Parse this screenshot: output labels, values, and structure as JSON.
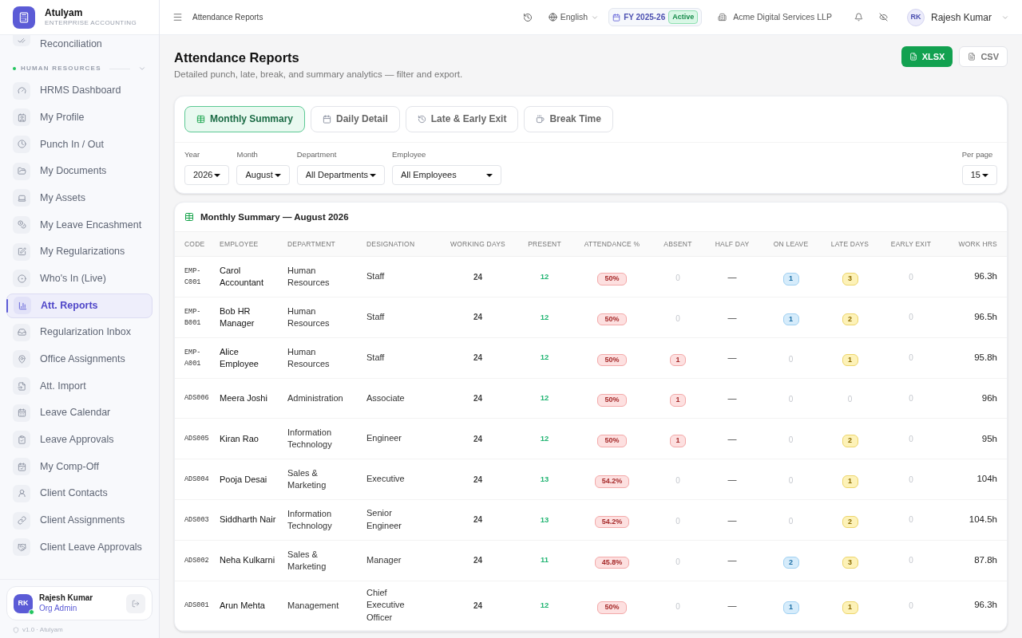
{
  "brand": {
    "name": "Atulyam",
    "tagline": "ENTERPRISE ACCOUNTING"
  },
  "sidebar": {
    "partial_item": "Reconciliation",
    "section": {
      "title": "HUMAN RESOURCES",
      "expanded": true
    },
    "items": [
      {
        "label": "HRMS Dashboard",
        "selected": false
      },
      {
        "label": "My Profile",
        "selected": false
      },
      {
        "label": "Punch In / Out",
        "selected": false
      },
      {
        "label": "My Documents",
        "selected": false
      },
      {
        "label": "My Assets",
        "selected": false
      },
      {
        "label": "My Leave Encashment",
        "selected": false
      },
      {
        "label": "My Regularizations",
        "selected": false
      },
      {
        "label": "Who's In (Live)",
        "selected": false
      },
      {
        "label": "Att. Reports",
        "selected": true
      },
      {
        "label": "Regularization Inbox",
        "selected": false
      },
      {
        "label": "Office Assignments",
        "selected": false
      },
      {
        "label": "Att. Import",
        "selected": false
      },
      {
        "label": "Leave Calendar",
        "selected": false
      },
      {
        "label": "Leave Approvals",
        "selected": false
      },
      {
        "label": "My Comp-Off",
        "selected": false
      },
      {
        "label": "Client Contacts",
        "selected": false
      },
      {
        "label": "Client Assignments",
        "selected": false
      },
      {
        "label": "Client Leave Approvals",
        "selected": false
      }
    ],
    "user": {
      "initials": "RK",
      "name": "Rajesh Kumar",
      "role": "Org Admin",
      "online": true
    },
    "version": "v1.0 · Atulyam"
  },
  "topbar": {
    "breadcrumb": "Attendance Reports",
    "language": "English",
    "fiscal_year": "FY 2025-26",
    "fy_status": "Active",
    "company": "Acme Digital Services LLP",
    "user_initials": "RK",
    "user_name": "Rajesh Kumar"
  },
  "page": {
    "title": "Attendance Reports",
    "subtitle": "Detailed punch, late, break, and summary analytics — filter and export.",
    "export_buttons": [
      "XLSX",
      "CSV"
    ]
  },
  "tabs": [
    {
      "label": "Monthly Summary",
      "selected": true
    },
    {
      "label": "Daily Detail",
      "selected": false
    },
    {
      "label": "Late & Early Exit",
      "selected": false
    },
    {
      "label": "Break Time",
      "selected": false
    }
  ],
  "filters": [
    {
      "label": "Year",
      "value": "2026"
    },
    {
      "label": "Month",
      "value": "August"
    },
    {
      "label": "Department",
      "value": "All Departments"
    },
    {
      "label": "Employee",
      "value": "All Employees"
    }
  ],
  "per_page": {
    "label": "Per page",
    "value": "15"
  },
  "table": {
    "title": "Monthly Summary — August 2026",
    "columns": [
      "CODE",
      "EMPLOYEE",
      "DEPARTMENT",
      "DESIGNATION",
      "WORKING DAYS",
      "PRESENT",
      "ATTENDANCE %",
      "ABSENT",
      "HALF DAY",
      "ON LEAVE",
      "LATE DAYS",
      "EARLY EXIT",
      "WORK HRS"
    ],
    "rows": [
      {
        "code": "EMP-C001",
        "employee": "Carol Accountant",
        "department": "Human Resources",
        "designation": "Staff",
        "working_days": "24",
        "present": "12",
        "attendance": "50%",
        "absent": {
          "text": "0",
          "flagged": false
        },
        "half_day": "—",
        "on_leave": {
          "text": "1",
          "flagged": true
        },
        "late_days": {
          "text": "3",
          "flagged": true
        },
        "early_exit": "0",
        "work_hrs": "96.3h"
      },
      {
        "code": "EMP-B001",
        "employee": "Bob HR Manager",
        "department": "Human Resources",
        "designation": "Staff",
        "working_days": "24",
        "present": "12",
        "attendance": "50%",
        "absent": {
          "text": "0",
          "flagged": false
        },
        "half_day": "—",
        "on_leave": {
          "text": "1",
          "flagged": true
        },
        "late_days": {
          "text": "2",
          "flagged": true
        },
        "early_exit": "0",
        "work_hrs": "96.5h"
      },
      {
        "code": "EMP-A001",
        "employee": "Alice Employee",
        "department": "Human Resources",
        "designation": "Staff",
        "working_days": "24",
        "present": "12",
        "attendance": "50%",
        "absent": {
          "text": "1",
          "flagged": true
        },
        "half_day": "—",
        "on_leave": {
          "text": "0",
          "flagged": false
        },
        "late_days": {
          "text": "1",
          "flagged": true
        },
        "early_exit": "0",
        "work_hrs": "95.8h"
      },
      {
        "code": "ADS006",
        "employee": "Meera Joshi",
        "department": "Administration",
        "designation": "Associate",
        "working_days": "24",
        "present": "12",
        "attendance": "50%",
        "absent": {
          "text": "1",
          "flagged": true
        },
        "half_day": "—",
        "on_leave": {
          "text": "0",
          "flagged": false
        },
        "late_days": {
          "text": "0",
          "flagged": false
        },
        "early_exit": "0",
        "work_hrs": "96h"
      },
      {
        "code": "ADS005",
        "employee": "Kiran Rao",
        "department": "Information Technology",
        "designation": "Engineer",
        "working_days": "24",
        "present": "12",
        "attendance": "50%",
        "absent": {
          "text": "1",
          "flagged": true
        },
        "half_day": "—",
        "on_leave": {
          "text": "0",
          "flagged": false
        },
        "late_days": {
          "text": "2",
          "flagged": true
        },
        "early_exit": "0",
        "work_hrs": "95h"
      },
      {
        "code": "ADS004",
        "employee": "Pooja Desai",
        "department": "Sales & Marketing",
        "designation": "Executive",
        "working_days": "24",
        "present": "13",
        "attendance": "54.2%",
        "absent": {
          "text": "0",
          "flagged": false
        },
        "half_day": "—",
        "on_leave": {
          "text": "0",
          "flagged": false
        },
        "late_days": {
          "text": "1",
          "flagged": true
        },
        "early_exit": "0",
        "work_hrs": "104h"
      },
      {
        "code": "ADS003",
        "employee": "Siddharth Nair",
        "department": "Information Technology",
        "designation": "Senior Engineer",
        "working_days": "24",
        "present": "13",
        "attendance": "54.2%",
        "absent": {
          "text": "0",
          "flagged": false
        },
        "half_day": "—",
        "on_leave": {
          "text": "0",
          "flagged": false
        },
        "late_days": {
          "text": "2",
          "flagged": true
        },
        "early_exit": "0",
        "work_hrs": "104.5h"
      },
      {
        "code": "ADS002",
        "employee": "Neha Kulkarni",
        "department": "Sales & Marketing",
        "designation": "Manager",
        "working_days": "24",
        "present": "11",
        "attendance": "45.8%",
        "absent": {
          "text": "0",
          "flagged": false
        },
        "half_day": "—",
        "on_leave": {
          "text": "2",
          "flagged": true
        },
        "late_days": {
          "text": "3",
          "flagged": true
        },
        "early_exit": "0",
        "work_hrs": "87.8h"
      },
      {
        "code": "ADS001",
        "employee": "Arun Mehta",
        "department": "Management",
        "designation": "Chief Executive Officer",
        "working_days": "24",
        "present": "12",
        "attendance": "50%",
        "absent": {
          "text": "0",
          "flagged": false
        },
        "half_day": "—",
        "on_leave": {
          "text": "1",
          "flagged": true
        },
        "late_days": {
          "text": "1",
          "flagged": true
        },
        "early_exit": "0",
        "work_hrs": "96.3h"
      }
    ]
  }
}
